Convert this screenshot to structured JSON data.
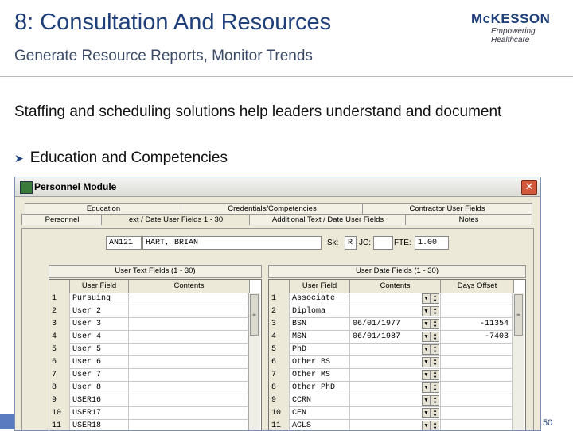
{
  "slide": {
    "title": "8: Consultation And Resources",
    "subtitle": "Generate Resource Reports, Monitor Trends",
    "body": "Staffing and scheduling solutions help leaders understand and document",
    "bullet": "Education and Competencies",
    "page_number": "50",
    "logo_name": "McKESSON",
    "logo_tagline": "Empowering Healthcare"
  },
  "window": {
    "title": "Personnel Module",
    "tabs_row1": [
      "Education",
      "Credentials/Competencies",
      "Contractor User Fields"
    ],
    "tabs_row2": [
      "Personnel",
      "ext / Date User Fields 1 - 30",
      "Additional Text / Date User Fields",
      "Notes"
    ],
    "employee_id": "AN121",
    "employee_name": "HART, BRIAN",
    "sk_label": "Sk:",
    "sk_value": "R",
    "jc_label": "JC:",
    "fte_label": "FTE:",
    "fte_value": "1.00"
  },
  "text_grid": {
    "title": "User Text Fields (1 - 30)",
    "headers": [
      "User Field",
      "Contents"
    ],
    "rows": [
      {
        "n": "1",
        "field": "Pursuing",
        "contents": ""
      },
      {
        "n": "2",
        "field": "User 2",
        "contents": ""
      },
      {
        "n": "3",
        "field": "User 3",
        "contents": ""
      },
      {
        "n": "4",
        "field": "User 4",
        "contents": ""
      },
      {
        "n": "5",
        "field": "User 5",
        "contents": ""
      },
      {
        "n": "6",
        "field": "User 6",
        "contents": ""
      },
      {
        "n": "7",
        "field": "User 7",
        "contents": ""
      },
      {
        "n": "8",
        "field": "User 8",
        "contents": ""
      },
      {
        "n": "9",
        "field": "USER16",
        "contents": ""
      },
      {
        "n": "10",
        "field": "USER17",
        "contents": ""
      },
      {
        "n": "11",
        "field": "USER18",
        "contents": ""
      }
    ]
  },
  "date_grid": {
    "title": "User Date Fields (1 - 30)",
    "headers": [
      "User Field",
      "Contents",
      "Days Offset"
    ],
    "rows": [
      {
        "n": "1",
        "field": "Associate",
        "contents": "",
        "offset": ""
      },
      {
        "n": "2",
        "field": "Diploma",
        "contents": "",
        "offset": ""
      },
      {
        "n": "3",
        "field": "BSN",
        "contents": "06/01/1977",
        "offset": "-11354"
      },
      {
        "n": "4",
        "field": "MSN",
        "contents": "06/01/1987",
        "offset": "-7403"
      },
      {
        "n": "5",
        "field": "PhD",
        "contents": "",
        "offset": ""
      },
      {
        "n": "6",
        "field": "Other BS",
        "contents": "",
        "offset": ""
      },
      {
        "n": "7",
        "field": "Other MS",
        "contents": "",
        "offset": ""
      },
      {
        "n": "8",
        "field": "Other PhD",
        "contents": "",
        "offset": ""
      },
      {
        "n": "9",
        "field": "CCRN",
        "contents": "",
        "offset": ""
      },
      {
        "n": "10",
        "field": "CEN",
        "contents": "",
        "offset": ""
      },
      {
        "n": "11",
        "field": "ACLS",
        "contents": "",
        "offset": ""
      }
    ]
  }
}
